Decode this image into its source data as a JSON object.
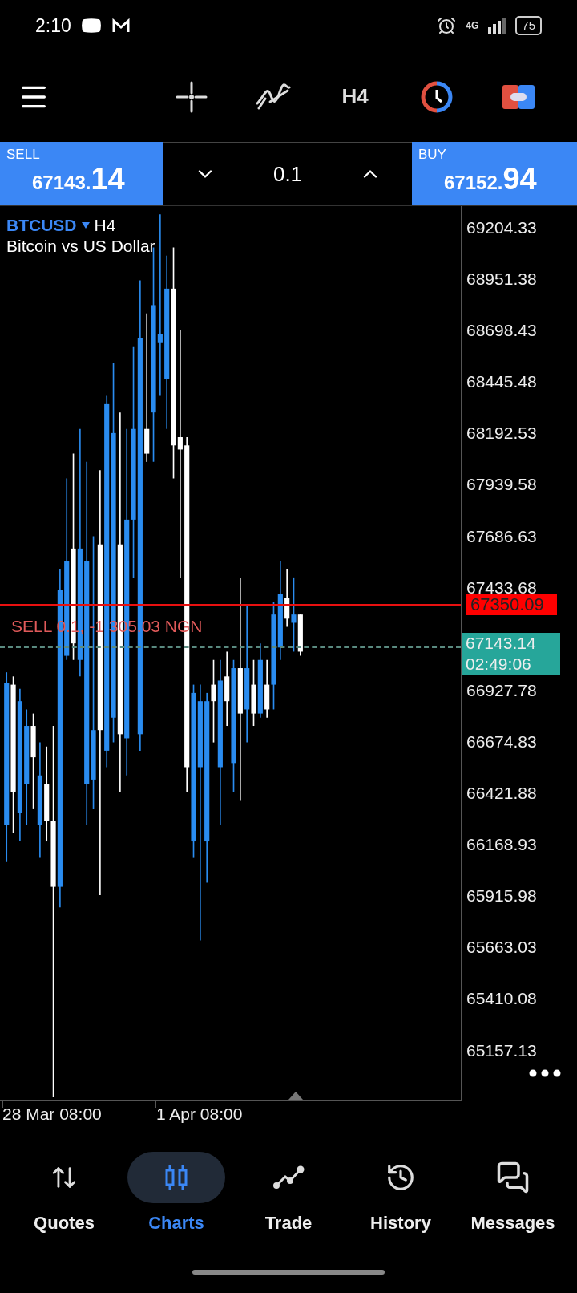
{
  "status_bar": {
    "time": "2:10",
    "network": "4G",
    "battery": "75"
  },
  "toolbar": {
    "timeframe": "H4"
  },
  "trade_bar": {
    "sell": {
      "label": "SELL",
      "price_main": "67143.",
      "price_tail": "14"
    },
    "volume": "0.1",
    "buy": {
      "label": "BUY",
      "price_main": "67152.",
      "price_tail": "94"
    }
  },
  "chart": {
    "symbol": "BTCUSD",
    "timeframe": "H4",
    "description": "Bitcoin vs US Dollar",
    "order_line": {
      "text": "SELL 0.1, -1 305.03 NGN"
    },
    "alert_price": "67350.09",
    "price_axis": [
      {
        "kind": "tick",
        "text": "69204.33"
      },
      {
        "kind": "tick",
        "text": "68951.38"
      },
      {
        "kind": "tick",
        "text": "68698.43"
      },
      {
        "kind": "tick",
        "text": "68445.48"
      },
      {
        "kind": "tick",
        "text": "68192.53"
      },
      {
        "kind": "tick",
        "text": "67939.58"
      },
      {
        "kind": "tick",
        "text": "67686.63"
      },
      {
        "kind": "tick",
        "text": "67433.68"
      },
      {
        "kind": "current",
        "price": "67143.14",
        "countdown": "02:49:06"
      },
      {
        "kind": "tick",
        "text": "66927.78"
      },
      {
        "kind": "tick",
        "text": "66674.83"
      },
      {
        "kind": "tick",
        "text": "66421.88"
      },
      {
        "kind": "tick",
        "text": "66168.93"
      },
      {
        "kind": "tick",
        "text": "65915.98"
      },
      {
        "kind": "tick",
        "text": "65663.03"
      },
      {
        "kind": "tick",
        "text": "65410.08"
      },
      {
        "kind": "tick",
        "text": "65157.13"
      }
    ],
    "time_axis": [
      "28 Mar 08:00",
      "1 Apr 08:00"
    ]
  },
  "bottom_nav": [
    {
      "label": "Quotes",
      "selected": false
    },
    {
      "label": "Charts",
      "selected": true
    },
    {
      "label": "Trade",
      "selected": false
    },
    {
      "label": "History",
      "selected": false
    },
    {
      "label": "Messages",
      "selected": false
    }
  ]
}
